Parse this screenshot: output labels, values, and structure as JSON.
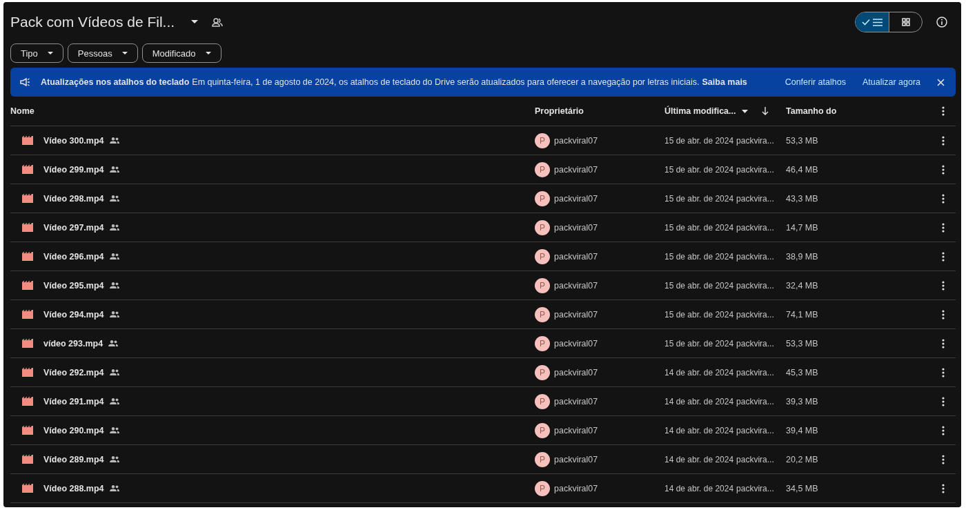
{
  "header": {
    "title": "Pack com Vídeos de Fil...",
    "view_toggle": [
      {
        "kind": "list",
        "selected": true
      },
      {
        "kind": "grid",
        "selected": false
      }
    ]
  },
  "filters": [
    {
      "label": "Tipo"
    },
    {
      "label": "Pessoas"
    },
    {
      "label": "Modificado"
    }
  ],
  "banner": {
    "title": "Atualizações nos atalhos do teclado",
    "message": "Em quinta-feira, 1 de agosto de 2024, os atalhos de teclado do Drive serão atualizados para oferecer a navegação por letras iniciais.",
    "link": "Saiba mais",
    "actions": [
      "Conferir atalhos",
      "Atualizar agora"
    ]
  },
  "table": {
    "columns": [
      "Nome",
      "Proprietário",
      "Última modifica...",
      "Tamanho do"
    ],
    "rows": [
      {
        "name": "Vídeo 300.mp4",
        "owner_initial": "P",
        "owner": "packviral07",
        "date": "15 de abr. de 2024",
        "modified_by": "packvira...",
        "size": "53,3 MB"
      },
      {
        "name": "Vídeo 299.mp4",
        "owner_initial": "P",
        "owner": "packviral07",
        "date": "15 de abr. de 2024",
        "modified_by": "packvira...",
        "size": "46,4 MB"
      },
      {
        "name": "Vídeo 298.mp4",
        "owner_initial": "P",
        "owner": "packviral07",
        "date": "15 de abr. de 2024",
        "modified_by": "packvira...",
        "size": "43,3 MB"
      },
      {
        "name": "Vídeo 297.mp4",
        "owner_initial": "P",
        "owner": "packviral07",
        "date": "15 de abr. de 2024",
        "modified_by": "packvira...",
        "size": "14,7 MB"
      },
      {
        "name": "Vídeo 296.mp4",
        "owner_initial": "P",
        "owner": "packviral07",
        "date": "15 de abr. de 2024",
        "modified_by": "packvira...",
        "size": "38,9 MB"
      },
      {
        "name": "Vídeo 295.mp4",
        "owner_initial": "P",
        "owner": "packviral07",
        "date": "15 de abr. de 2024",
        "modified_by": "packvira...",
        "size": "32,4 MB"
      },
      {
        "name": "Vídeo 294.mp4",
        "owner_initial": "P",
        "owner": "packviral07",
        "date": "15 de abr. de 2024",
        "modified_by": "packvira...",
        "size": "74,1 MB"
      },
      {
        "name": "vídeo 293.mp4",
        "owner_initial": "P",
        "owner": "packviral07",
        "date": "15 de abr. de 2024",
        "modified_by": "packvira...",
        "size": "53,3 MB"
      },
      {
        "name": "Vídeo 292.mp4",
        "owner_initial": "P",
        "owner": "packviral07",
        "date": "14 de abr. de 2024",
        "modified_by": "packvira...",
        "size": "45,3 MB"
      },
      {
        "name": "Vídeo 291.mp4",
        "owner_initial": "P",
        "owner": "packviral07",
        "date": "14 de abr. de 2024",
        "modified_by": "packvira...",
        "size": "39,3 MB"
      },
      {
        "name": "Vídeo 290.mp4",
        "owner_initial": "P",
        "owner": "packviral07",
        "date": "14 de abr. de 2024",
        "modified_by": "packvira...",
        "size": "39,4 MB"
      },
      {
        "name": "Vídeo 289.mp4",
        "owner_initial": "P",
        "owner": "packviral07",
        "date": "14 de abr. de 2024",
        "modified_by": "packvira...",
        "size": "20,2 MB"
      },
      {
        "name": "Vídeo 288.mp4",
        "owner_initial": "P",
        "owner": "packviral07",
        "date": "14 de abr. de 2024",
        "modified_by": "packvira...",
        "size": "34,5 MB"
      }
    ]
  }
}
